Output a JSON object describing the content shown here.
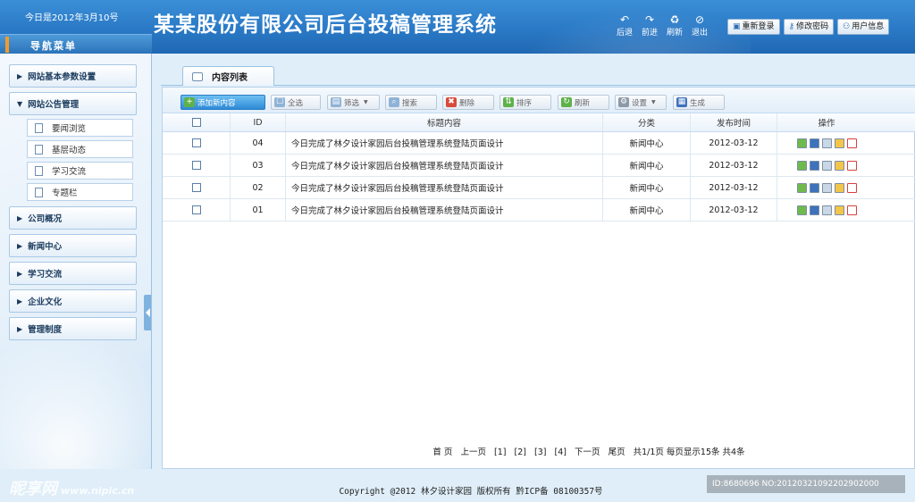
{
  "header": {
    "date": "今日是2012年3月10号",
    "title": "某某股份有限公司后台投稿管理系统",
    "nav": [
      {
        "label": "后退",
        "icon": "back-icon"
      },
      {
        "label": "前进",
        "icon": "forward-icon"
      },
      {
        "label": "刷新",
        "icon": "refresh-icon"
      },
      {
        "label": "退出",
        "icon": "exit-icon"
      }
    ],
    "buttons": [
      {
        "label": "重新登录",
        "icon": "login-icon"
      },
      {
        "label": "修改密码",
        "icon": "key-icon"
      },
      {
        "label": "用户信息",
        "icon": "user-icon"
      }
    ]
  },
  "sidebar": {
    "title": "导航菜单",
    "items": [
      {
        "label": "网站基本参数设置"
      },
      {
        "label": "网站公告管理",
        "expanded": true,
        "children": [
          {
            "label": "要闻浏览"
          },
          {
            "label": "基层动态"
          },
          {
            "label": "学习交流"
          },
          {
            "label": "专题栏"
          }
        ]
      },
      {
        "label": "公司概况"
      },
      {
        "label": "新闻中心"
      },
      {
        "label": "学习交流"
      },
      {
        "label": "企业文化"
      },
      {
        "label": "管理制度"
      }
    ]
  },
  "main": {
    "tab": "内容列表",
    "toolbar": [
      {
        "label": "添加新内容",
        "icon": "add-icon",
        "primary": true
      },
      {
        "label": "全选",
        "icon": "select-all-icon"
      },
      {
        "label": "筛选",
        "icon": "filter-icon",
        "dropdown": true
      },
      {
        "label": "搜索",
        "icon": "search-icon"
      },
      {
        "label": "删除",
        "icon": "delete-icon"
      },
      {
        "label": "排序",
        "icon": "sort-icon"
      },
      {
        "label": "刷新",
        "icon": "refresh-icon"
      },
      {
        "label": "设置",
        "icon": "settings-icon",
        "dropdown": true
      },
      {
        "label": "生成",
        "icon": "generate-icon"
      }
    ],
    "columns": [
      "ID",
      "标题内容",
      "分类",
      "发布时间",
      "操作"
    ],
    "rows": [
      {
        "id": "04",
        "title": "今日完成了林夕设计家园后台投稿管理系统登陆页面设计",
        "category": "新闻中心",
        "date": "2012-03-12"
      },
      {
        "id": "03",
        "title": "今日完成了林夕设计家园后台投稿管理系统登陆页面设计",
        "category": "新闻中心",
        "date": "2012-03-12"
      },
      {
        "id": "02",
        "title": "今日完成了林夕设计家园后台投稿管理系统登陆页面设计",
        "category": "新闻中心",
        "date": "2012-03-12"
      },
      {
        "id": "01",
        "title": "今日完成了林夕设计家园后台投稿管理系统登陆页面设计",
        "category": "新闻中心",
        "date": "2012-03-12"
      }
    ],
    "row_actions": [
      "edit-icon",
      "book-icon",
      "view-icon",
      "copy-icon",
      "delete-icon"
    ],
    "pager": {
      "first": "首 页",
      "prev": "上一页",
      "pages": [
        "[1]",
        "[2]",
        "[3]",
        "[4]"
      ],
      "next": "下一页",
      "last": "尾页",
      "info": "共1/1页 每页显示15条 共4条"
    }
  },
  "footer": {
    "copyright": "Copyright @2012 林夕设计家园 版权所有 黔ICP备 08100357号"
  },
  "watermarks": {
    "left": "昵享网",
    "left_url": "www.nipic.cn",
    "right": "ID:8680696 NO:20120321092202902000"
  },
  "colors": {
    "header": "#2a79c6",
    "accent": "#f29b2b",
    "primary_button": "#2d8ad6"
  }
}
